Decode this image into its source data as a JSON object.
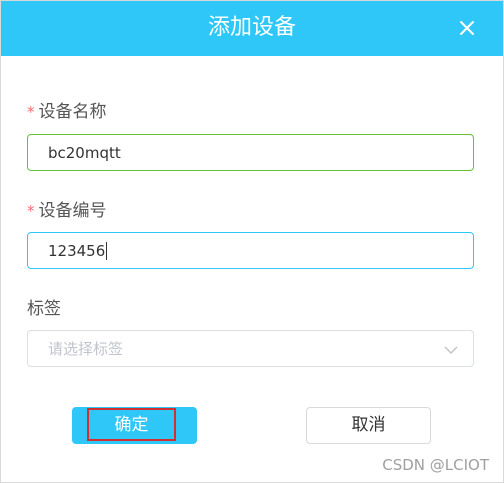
{
  "dialog": {
    "title": "添加设备",
    "close_icon": "close-icon"
  },
  "form": {
    "name_label": "设备名称",
    "name_required_mark": "*",
    "name_value": "bc20mqtt",
    "number_label": "设备编号",
    "number_required_mark": "*",
    "number_value": "123456",
    "tag_label": "标签",
    "tag_placeholder": "请选择标签",
    "tag_dropdown_icon": "chevron-down-icon"
  },
  "buttons": {
    "confirm_label": "确定",
    "cancel_label": "取消"
  },
  "watermark": "CSDN @LCIOT",
  "colors": {
    "header": "#2ec7f7",
    "required": "#f56c6c",
    "valid_border": "#67c23a",
    "focus_border": "#2ec7f7",
    "highlight_box": "#d32f2f"
  }
}
